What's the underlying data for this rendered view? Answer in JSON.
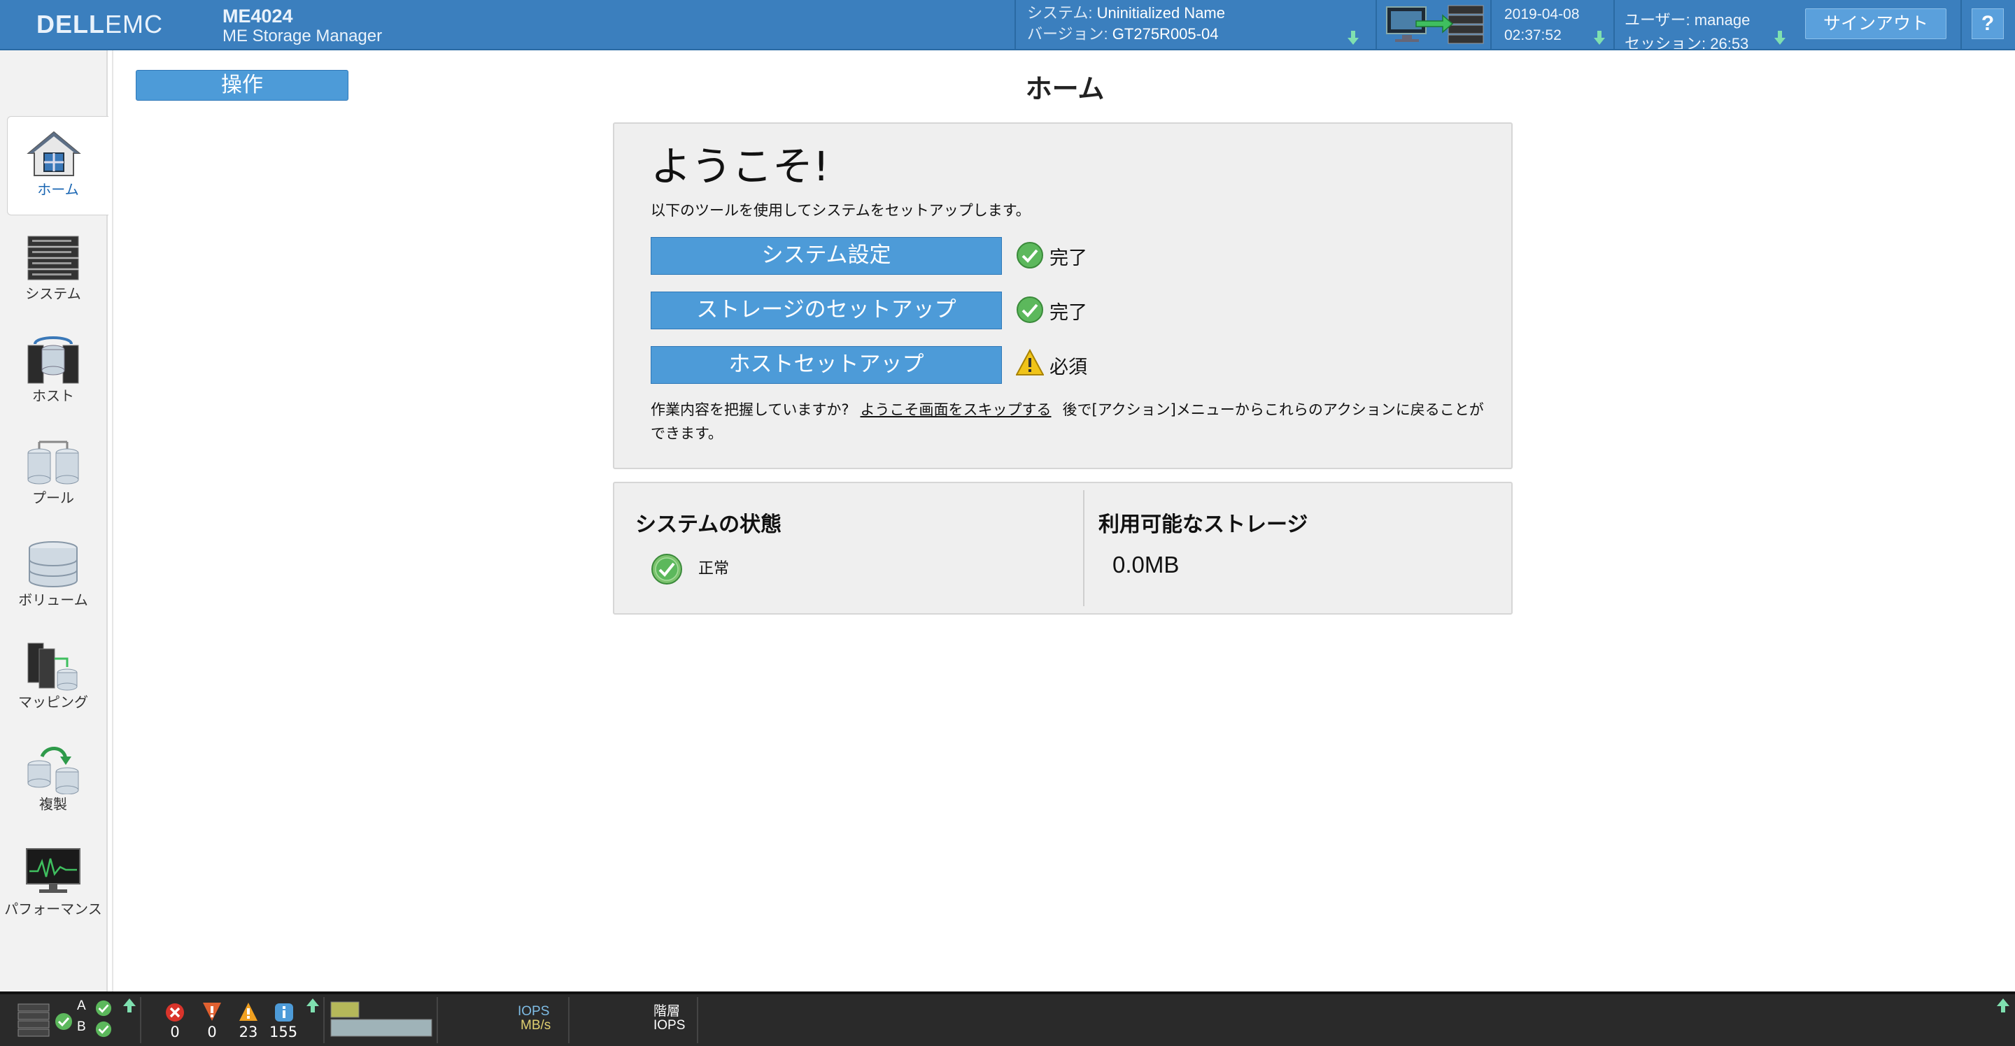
{
  "header": {
    "brand": "DELL EMC",
    "brand_dell": "DELL",
    "brand_emc": "EMC",
    "model": "ME4024",
    "product": "ME Storage Manager",
    "system_label": "システム: ",
    "system_value": "Uninitialized Name",
    "version_label": "バージョン: ",
    "version_value": "GT275R005-04",
    "date": "2019-04-08",
    "time": "02:37:52",
    "user_label": "ユーザー: ",
    "user_value": "manage",
    "session_label": "セッション: ",
    "session_value": "26:53",
    "signout_label": "サインアウト",
    "help_label": "?"
  },
  "sidebar": {
    "items": [
      {
        "label": "ホーム",
        "icon": "home-icon",
        "active": true
      },
      {
        "label": "システム",
        "icon": "system-rack-icon"
      },
      {
        "label": "ホスト",
        "icon": "hosts-icon"
      },
      {
        "label": "プール",
        "icon": "pools-icon"
      },
      {
        "label": "ボリューム",
        "icon": "volumes-icon"
      },
      {
        "label": "マッピング",
        "icon": "mapping-icon"
      },
      {
        "label": "複製",
        "icon": "replication-icon"
      },
      {
        "label": "パフォーマンス",
        "icon": "performance-icon"
      }
    ]
  },
  "main": {
    "actions_label": "操作",
    "title": "ホーム",
    "welcome": {
      "heading": "ようこそ!",
      "intro": "以下のツールを使用してシステムをセットアップします。",
      "steps": [
        {
          "label": "システム設定",
          "status": "完了",
          "status_type": "complete"
        },
        {
          "label": "ストレージのセットアップ",
          "status": "完了",
          "status_type": "complete"
        },
        {
          "label": "ホストセットアップ",
          "status": "必須",
          "status_type": "required"
        }
      ],
      "note_prefix": "作業内容を把握していますか?",
      "skip_link": "ようこそ画面をスキップする",
      "note_suffix": "後で[アクション]メニューからこれらのアクションに戻ることができます。"
    },
    "system_status": {
      "heading": "システムの状態",
      "value": "正常"
    },
    "storage": {
      "heading": "利用可能なストレージ",
      "value": "0.0MB"
    }
  },
  "footer": {
    "controller_a": "A",
    "controller_b": "B",
    "counts": {
      "critical": "0",
      "error": "0",
      "warning": "23",
      "info": "155"
    },
    "perf_label_1": "IOPS",
    "perf_label_2": "MB/s",
    "tier_label_1": "階層",
    "tier_label_2": "IOPS"
  },
  "colors": {
    "header_bg": "#3b7fbe",
    "button_blue": "#4d9bd8",
    "ok_green": "#5cb85c",
    "warn_yellow": "#f0c419",
    "footer_bg": "#2a2a2a"
  }
}
